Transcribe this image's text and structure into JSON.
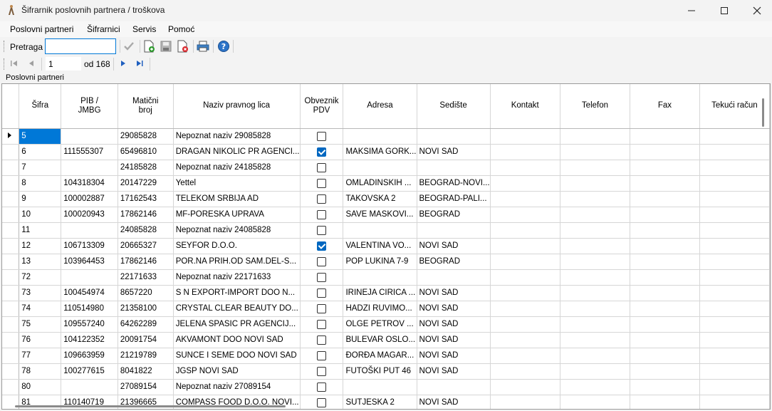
{
  "window": {
    "title": "Šifrarnik poslovnih partnera / troškova"
  },
  "menu": [
    "Poslovni partneri",
    "Šifrarnici",
    "Servis",
    "Pomoć"
  ],
  "search": {
    "label": "Pretraga",
    "value": ""
  },
  "navigator": {
    "position": "1",
    "of_label": "od 168"
  },
  "panel_label": "Poslovni partneri",
  "columns": [
    "Šifra",
    "PIB / JMBG",
    "Matični broj",
    "Naziv pravnog lica",
    "Obveznik PDV",
    "Adresa",
    "Sedište",
    "Kontakt",
    "Telefon",
    "Fax",
    "Tekući račun"
  ],
  "rows": [
    {
      "sifra": "5",
      "pib": "",
      "mb": "29085828",
      "naziv": "Nepoznat naziv 29085828",
      "pdv": false,
      "adresa": "",
      "sediste": ""
    },
    {
      "sifra": "6",
      "pib": "111555307",
      "mb": "65496810",
      "naziv": "DRAGAN NIKOLIC PR AGENCI...",
      "pdv": true,
      "adresa": "MAKSIMA GORK...",
      "sediste": "NOVI SAD"
    },
    {
      "sifra": "7",
      "pib": "",
      "mb": "24185828",
      "naziv": "Nepoznat naziv 24185828",
      "pdv": false,
      "adresa": "",
      "sediste": ""
    },
    {
      "sifra": "8",
      "pib": "104318304",
      "mb": "20147229",
      "naziv": "Yettel",
      "pdv": false,
      "adresa": "OMLADINSKIH ...",
      "sediste": "BEOGRAD-NOVI..."
    },
    {
      "sifra": "9",
      "pib": "100002887",
      "mb": "17162543",
      "naziv": "TELEKOM SRBIJA AD",
      "pdv": false,
      "adresa": "TAKOVSKA 2",
      "sediste": "BEOGRAD-PALI..."
    },
    {
      "sifra": "10",
      "pib": "100020943",
      "mb": "17862146",
      "naziv": "MF-PORESKA UPRAVA",
      "pdv": false,
      "adresa": "SAVE MASKOVI...",
      "sediste": "BEOGRAD"
    },
    {
      "sifra": "11",
      "pib": "",
      "mb": "24085828",
      "naziv": "Nepoznat naziv 24085828",
      "pdv": false,
      "adresa": "",
      "sediste": ""
    },
    {
      "sifra": "12",
      "pib": "106713309",
      "mb": "20665327",
      "naziv": "SEYFOR D.O.O.",
      "pdv": true,
      "adresa": "VALENTINA VO...",
      "sediste": "NOVI SAD"
    },
    {
      "sifra": "13",
      "pib": "103964453",
      "mb": "17862146",
      "naziv": "POR.NA PRIH.OD SAM.DEL-S...",
      "pdv": false,
      "adresa": "POP LUKINA 7-9",
      "sediste": "BEOGRAD"
    },
    {
      "sifra": "72",
      "pib": "",
      "mb": "22171633",
      "naziv": "Nepoznat naziv 22171633",
      "pdv": false,
      "adresa": "",
      "sediste": ""
    },
    {
      "sifra": "73",
      "pib": "100454974",
      "mb": "8657220",
      "naziv": "S  N EXPORT-IMPORT DOO N...",
      "pdv": false,
      "adresa": "IRINEJA CIRICA ...",
      "sediste": "NOVI SAD"
    },
    {
      "sifra": "74",
      "pib": "110514980",
      "mb": "21358100",
      "naziv": "CRYSTAL CLEAR BEAUTY DO...",
      "pdv": false,
      "adresa": "HADZI RUVIMO...",
      "sediste": "NOVI SAD"
    },
    {
      "sifra": "75",
      "pib": "109557240",
      "mb": "64262289",
      "naziv": "JELENA SPASIC PR AGENCIJ...",
      "pdv": false,
      "adresa": "OLGE PETROV ...",
      "sediste": "NOVI SAD"
    },
    {
      "sifra": "76",
      "pib": "104122352",
      "mb": "20091754",
      "naziv": "AKVAMONT DOO NOVI SAD",
      "pdv": false,
      "adresa": "BULEVAR OSLO...",
      "sediste": "NOVI SAD"
    },
    {
      "sifra": "77",
      "pib": "109663959",
      "mb": "21219789",
      "naziv": "SUNCE I SEME DOO NOVI SAD",
      "pdv": false,
      "adresa": "ĐORĐA MAGAR...",
      "sediste": "NOVI SAD"
    },
    {
      "sifra": "78",
      "pib": "100277615",
      "mb": "8041822",
      "naziv": "JGSP NOVI SAD",
      "pdv": false,
      "adresa": "FUTOŠKI PUT 46",
      "sediste": "NOVI SAD"
    },
    {
      "sifra": "80",
      "pib": "",
      "mb": "27089154",
      "naziv": "Nepoznat naziv 27089154",
      "pdv": false,
      "adresa": "",
      "sediste": ""
    },
    {
      "sifra": "81",
      "pib": "110140719",
      "mb": "21396665",
      "naziv": "COMPASS FOOD D.O.O. NOVI...",
      "pdv": false,
      "adresa": "SUTJESKA 2",
      "sediste": "NOVI SAD"
    }
  ]
}
